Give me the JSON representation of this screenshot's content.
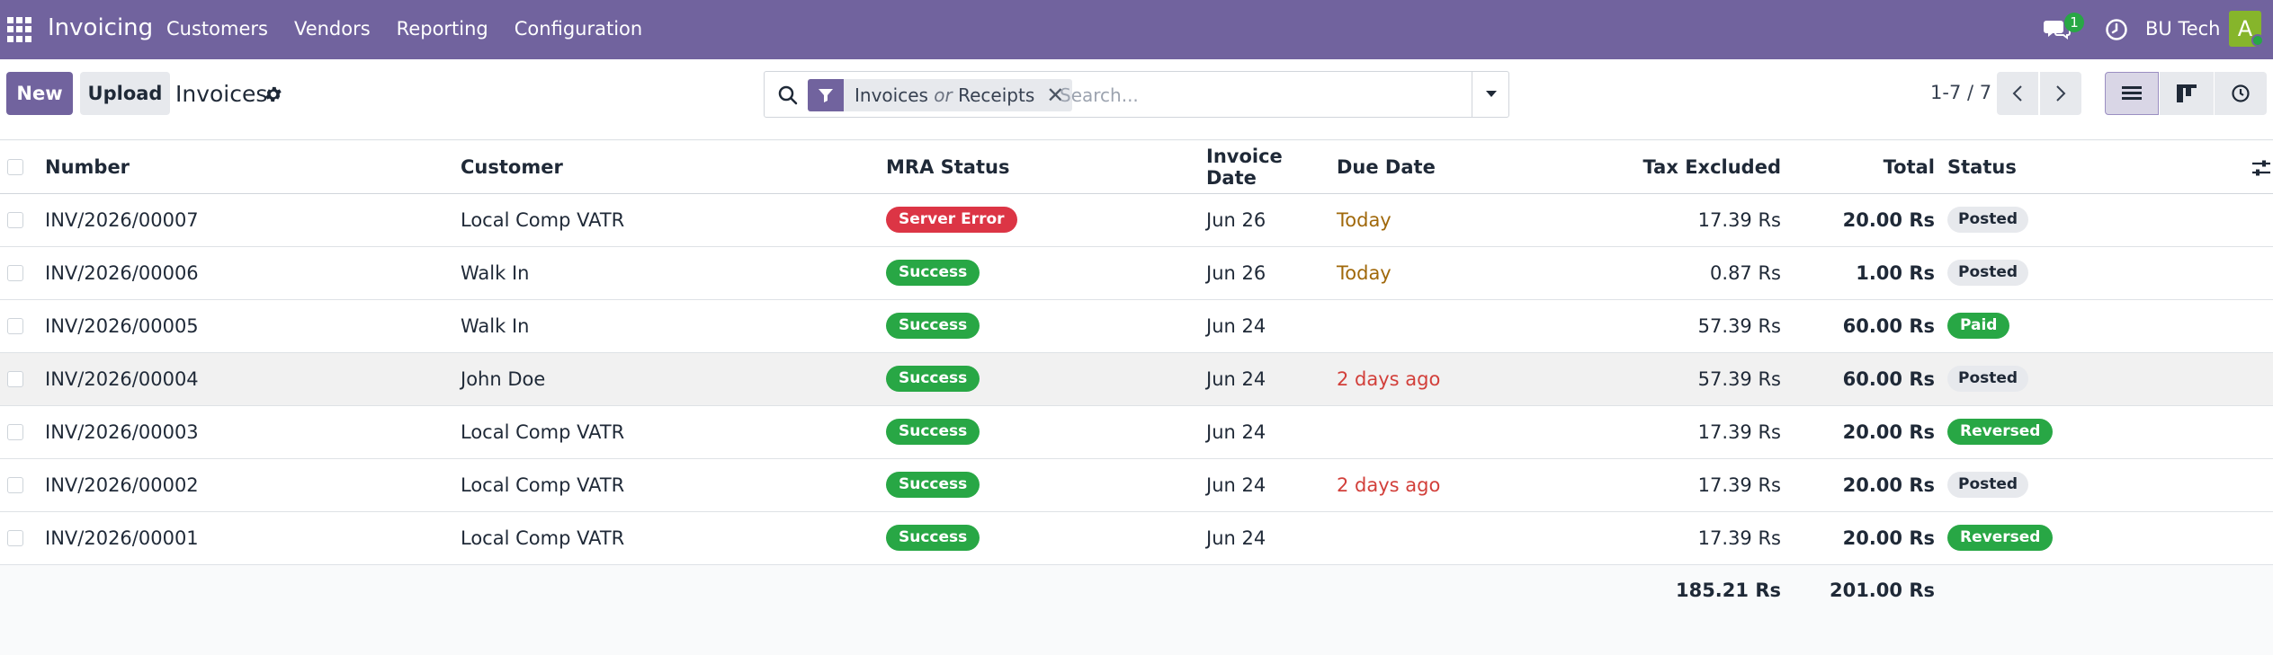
{
  "navbar": {
    "brand": "Invoicing",
    "menu": [
      "Customers",
      "Vendors",
      "Reporting",
      "Configuration"
    ],
    "chat_badge": "1",
    "company": "BU Tech",
    "avatar_letter": "A",
    "color": "#71639e"
  },
  "control": {
    "new_label": "New",
    "upload_label": "Upload",
    "breadcrumb": "Invoices",
    "facet": {
      "part1": "Invoices",
      "or": "or",
      "part2": "Receipts"
    },
    "search_placeholder": "Search...",
    "pager": "1-7 / 7"
  },
  "table": {
    "headers": {
      "number": "Number",
      "customer": "Customer",
      "mra_status": "MRA Status",
      "invoice_date": "Invoice Date",
      "due_date": "Due Date",
      "tax_excluded": "Tax Excluded",
      "total": "Total",
      "status": "Status"
    },
    "rows": [
      {
        "number": "INV/2026/00007",
        "customer": "Local Comp VATR",
        "mra": "Server Error",
        "mra_type": "danger",
        "invoice_date": "Jun 26",
        "due_date": "Today",
        "due_type": "warning",
        "tax_excluded": "17.39 Rs",
        "total": "20.00 Rs",
        "status": "Posted",
        "status_type": "muted"
      },
      {
        "number": "INV/2026/00006",
        "customer": "Walk In",
        "mra": "Success",
        "mra_type": "success",
        "invoice_date": "Jun 26",
        "due_date": "Today",
        "due_type": "warning",
        "tax_excluded": "0.87 Rs",
        "total": "1.00 Rs",
        "status": "Posted",
        "status_type": "muted"
      },
      {
        "number": "INV/2026/00005",
        "customer": "Walk In",
        "mra": "Success",
        "mra_type": "success",
        "invoice_date": "Jun 24",
        "due_date": "",
        "due_type": "",
        "tax_excluded": "57.39 Rs",
        "total": "60.00 Rs",
        "status": "Paid",
        "status_type": "success"
      },
      {
        "number": "INV/2026/00004",
        "customer": "John Doe",
        "mra": "Success",
        "mra_type": "success",
        "invoice_date": "Jun 24",
        "due_date": "2 days ago",
        "due_type": "danger",
        "tax_excluded": "57.39 Rs",
        "total": "60.00 Rs",
        "status": "Posted",
        "status_type": "muted"
      },
      {
        "number": "INV/2026/00003",
        "customer": "Local Comp VATR",
        "mra": "Success",
        "mra_type": "success",
        "invoice_date": "Jun 24",
        "due_date": "",
        "due_type": "",
        "tax_excluded": "17.39 Rs",
        "total": "20.00 Rs",
        "status": "Reversed",
        "status_type": "success"
      },
      {
        "number": "INV/2026/00002",
        "customer": "Local Comp VATR",
        "mra": "Success",
        "mra_type": "success",
        "invoice_date": "Jun 24",
        "due_date": "2 days ago",
        "due_type": "danger",
        "tax_excluded": "17.39 Rs",
        "total": "20.00 Rs",
        "status": "Posted",
        "status_type": "muted"
      },
      {
        "number": "INV/2026/00001",
        "customer": "Local Comp VATR",
        "mra": "Success",
        "mra_type": "success",
        "invoice_date": "Jun 24",
        "due_date": "",
        "due_type": "",
        "tax_excluded": "17.39 Rs",
        "total": "20.00 Rs",
        "status": "Reversed",
        "status_type": "success"
      }
    ],
    "totals": {
      "tax_excluded": "185.21 Rs",
      "total": "201.00 Rs"
    }
  }
}
